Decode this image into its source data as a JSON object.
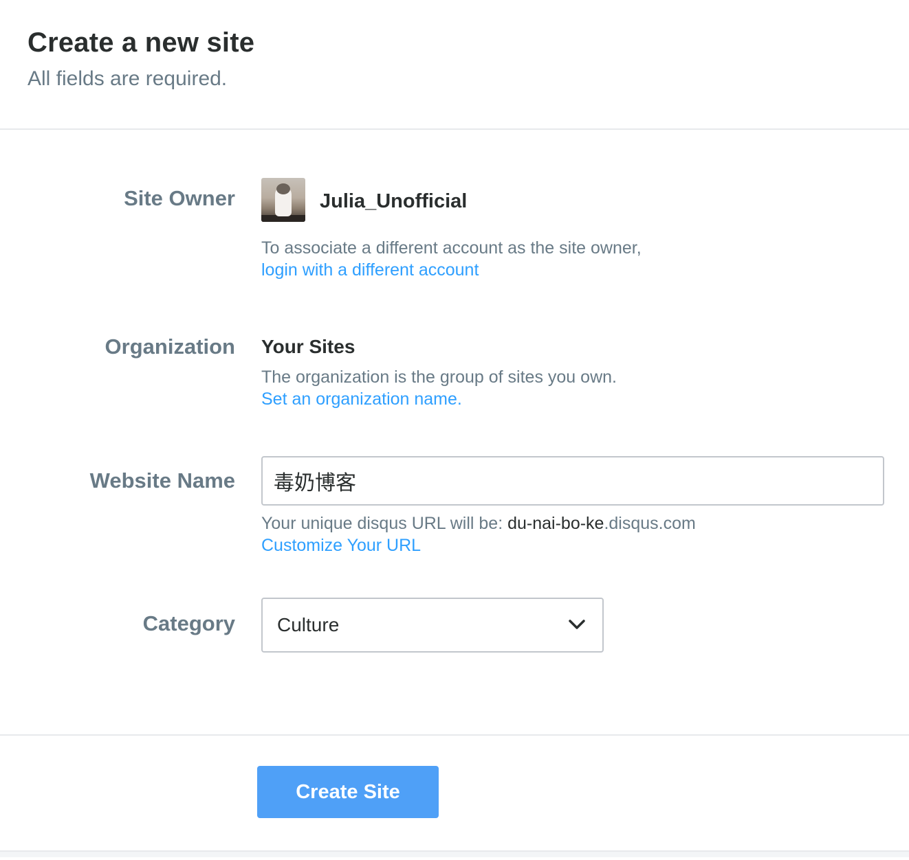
{
  "header": {
    "title": "Create a new site",
    "subtitle": "All fields are required."
  },
  "site_owner": {
    "label": "Site Owner",
    "username": "Julia_Unofficial",
    "help_text": "To associate a different account as the site owner,",
    "link": "login with a different account"
  },
  "organization": {
    "label": "Organization",
    "name": "Your Sites",
    "help_text": "The organization is the group of sites you own.",
    "link": "Set an organization name."
  },
  "website_name": {
    "label": "Website Name",
    "value": "毒奶博客",
    "url_prefix": "Your unique disqus URL will be: ",
    "url_slug": "du-nai-bo-ke",
    "url_suffix": ".disqus.com",
    "link": "Customize Your URL"
  },
  "category": {
    "label": "Category",
    "selected": "Culture"
  },
  "footer": {
    "submit_label": "Create Site"
  },
  "colors": {
    "link": "#2e9fff",
    "button": "#4fa0f7",
    "label": "#687a86"
  }
}
